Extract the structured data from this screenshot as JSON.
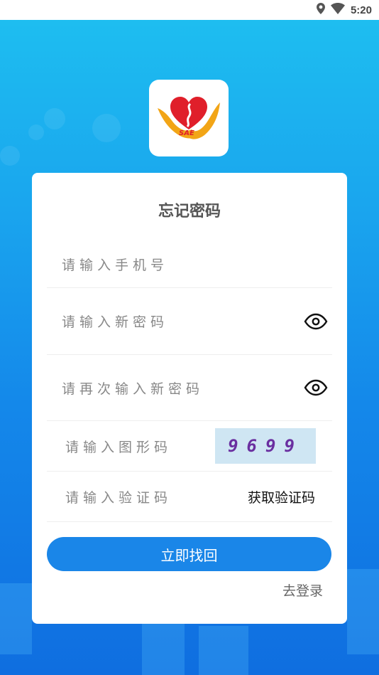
{
  "status_bar": {
    "time": "5:20",
    "icons": [
      "location-icon",
      "wifi-icon"
    ]
  },
  "logo": {
    "text": "SAE",
    "colors": {
      "heart": "#e01f2a",
      "hands": "#f2a516"
    }
  },
  "form": {
    "title": "忘记密码",
    "phone_placeholder": "请输入手机号",
    "new_password_placeholder": "请输入新密码",
    "confirm_password_placeholder": "请再次输入新密码",
    "captcha_placeholder": "请输入图形码",
    "captcha_text": "9699",
    "sms_code_placeholder": "请输入验证码",
    "get_code_label": "获取验证码",
    "submit_label": "立即找回",
    "login_link": "去登录"
  },
  "colors": {
    "accent": "#1a86e8",
    "background_top": "#1ec0f0",
    "background_bottom": "#0f6ee0"
  }
}
